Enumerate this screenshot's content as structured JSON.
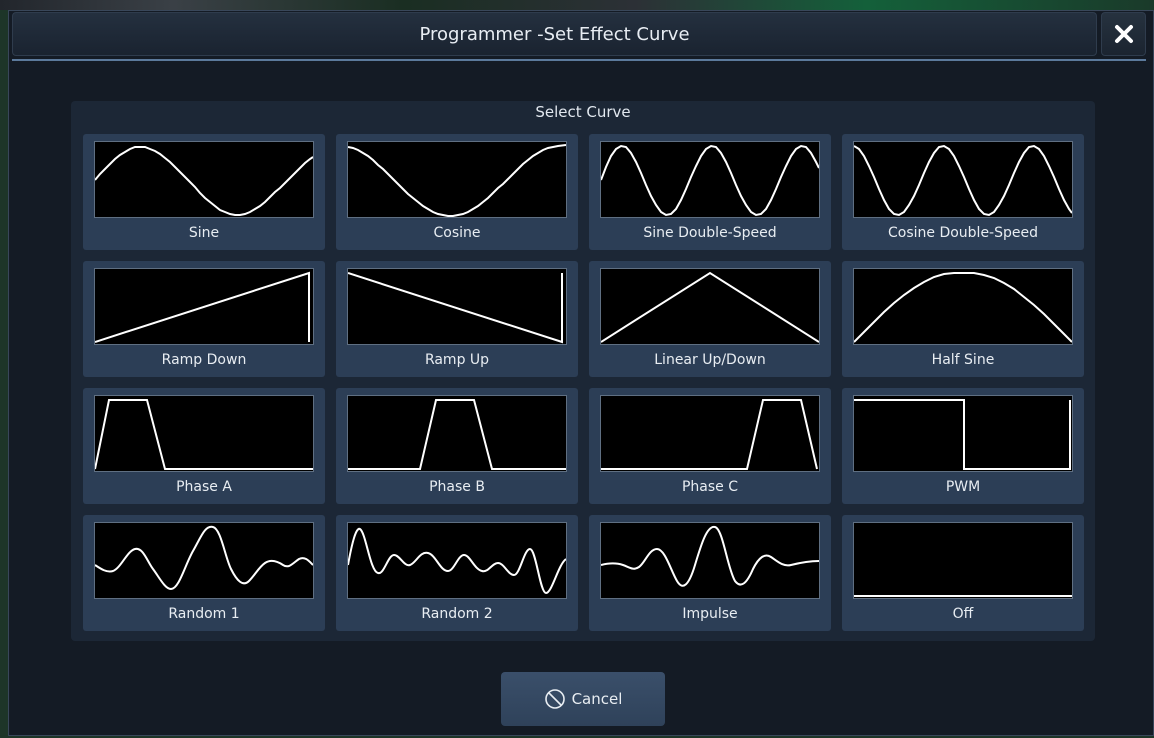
{
  "dialog": {
    "title": "Programmer -Set Effect Curve",
    "close_icon": "close-icon"
  },
  "panel": {
    "label": "Select Curve",
    "curves": [
      {
        "label": "Sine",
        "icon": "sine-curve-icon"
      },
      {
        "label": "Cosine",
        "icon": "cosine-curve-icon"
      },
      {
        "label": "Sine Double-Speed",
        "icon": "sine-double-speed-curve-icon"
      },
      {
        "label": "Cosine Double-Speed",
        "icon": "cosine-double-speed-curve-icon"
      },
      {
        "label": "Ramp Down",
        "icon": "ramp-down-curve-icon"
      },
      {
        "label": "Ramp Up",
        "icon": "ramp-up-curve-icon"
      },
      {
        "label": "Linear Up/Down",
        "icon": "linear-up-down-curve-icon"
      },
      {
        "label": "Half Sine",
        "icon": "half-sine-curve-icon"
      },
      {
        "label": "Phase A",
        "icon": "phase-a-curve-icon"
      },
      {
        "label": "Phase B",
        "icon": "phase-b-curve-icon"
      },
      {
        "label": "Phase C",
        "icon": "phase-c-curve-icon"
      },
      {
        "label": "PWM",
        "icon": "pwm-curve-icon"
      },
      {
        "label": "Random 1",
        "icon": "random-1-curve-icon"
      },
      {
        "label": "Random 2",
        "icon": "random-2-curve-icon"
      },
      {
        "label": "Impulse",
        "icon": "impulse-curve-icon"
      },
      {
        "label": "Off",
        "icon": "off-curve-icon"
      }
    ]
  },
  "footer": {
    "cancel_label": "Cancel",
    "cancel_icon": "cancel-icon"
  },
  "colors": {
    "dialog_bg": "#141b25",
    "panel_bg": "#1c2736",
    "tile_bg": "#2c3e56",
    "preview_bg": "#000000",
    "curve_stroke": "#ffffff",
    "title_underline": "#5c7a9c"
  }
}
